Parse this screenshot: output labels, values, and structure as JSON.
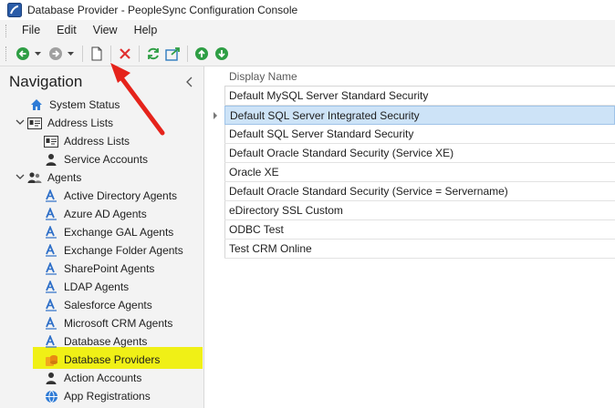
{
  "window": {
    "title": "Database Provider - PeopleSync Configuration Console"
  },
  "menu": {
    "items": [
      "File",
      "Edit",
      "View",
      "Help"
    ]
  },
  "toolbar": {
    "buttons": [
      "back-icon",
      "forward-icon",
      "new-document-icon",
      "delete-icon",
      "refresh-icon",
      "export-icon",
      "move-up-icon",
      "move-down-icon"
    ]
  },
  "navigation": {
    "header": "Navigation",
    "items": [
      {
        "label": "System Status",
        "icon": "home-icon"
      },
      {
        "label": "Address Lists",
        "icon": "address-card-icon"
      },
      {
        "label": "Address Lists",
        "icon": "address-card-icon"
      },
      {
        "label": "Service Accounts",
        "icon": "person-icon"
      },
      {
        "label": "Agents",
        "icon": "people-icon"
      },
      {
        "label": "Active Directory Agents",
        "icon": "agent-icon"
      },
      {
        "label": "Azure AD Agents",
        "icon": "agent-icon"
      },
      {
        "label": "Exchange GAL Agents",
        "icon": "agent-icon"
      },
      {
        "label": "Exchange Folder Agents",
        "icon": "agent-icon"
      },
      {
        "label": "SharePoint Agents",
        "icon": "agent-icon"
      },
      {
        "label": "LDAP Agents",
        "icon": "agent-icon"
      },
      {
        "label": "Salesforce Agents",
        "icon": "agent-icon"
      },
      {
        "label": "Microsoft CRM Agents",
        "icon": "agent-icon"
      },
      {
        "label": "Database Agents",
        "icon": "agent-icon"
      },
      {
        "label": "Database Providers",
        "icon": "database-provider-icon"
      },
      {
        "label": "Action Accounts",
        "icon": "person-icon"
      },
      {
        "label": "App Registrations",
        "icon": "globe-icon"
      }
    ]
  },
  "grid": {
    "column_header": "Display Name",
    "rows": [
      "Default MySQL Server Standard Security",
      "Default SQL Server Integrated Security",
      "Default SQL Server Standard Security",
      "Default Oracle Standard Security (Service XE)",
      "Oracle XE",
      "Default Oracle Standard Security (Service = Servername)",
      "eDirectory SSL Custom",
      "ODBC Test",
      "Test CRM Online"
    ],
    "selected_index": 1
  },
  "colors": {
    "accent_green": "#2e9e44",
    "delete_red": "#e03030",
    "highlight_yellow": "#f0f016",
    "selection_blue": "#cde3f7",
    "annotation_arrow": "#e5231b"
  }
}
